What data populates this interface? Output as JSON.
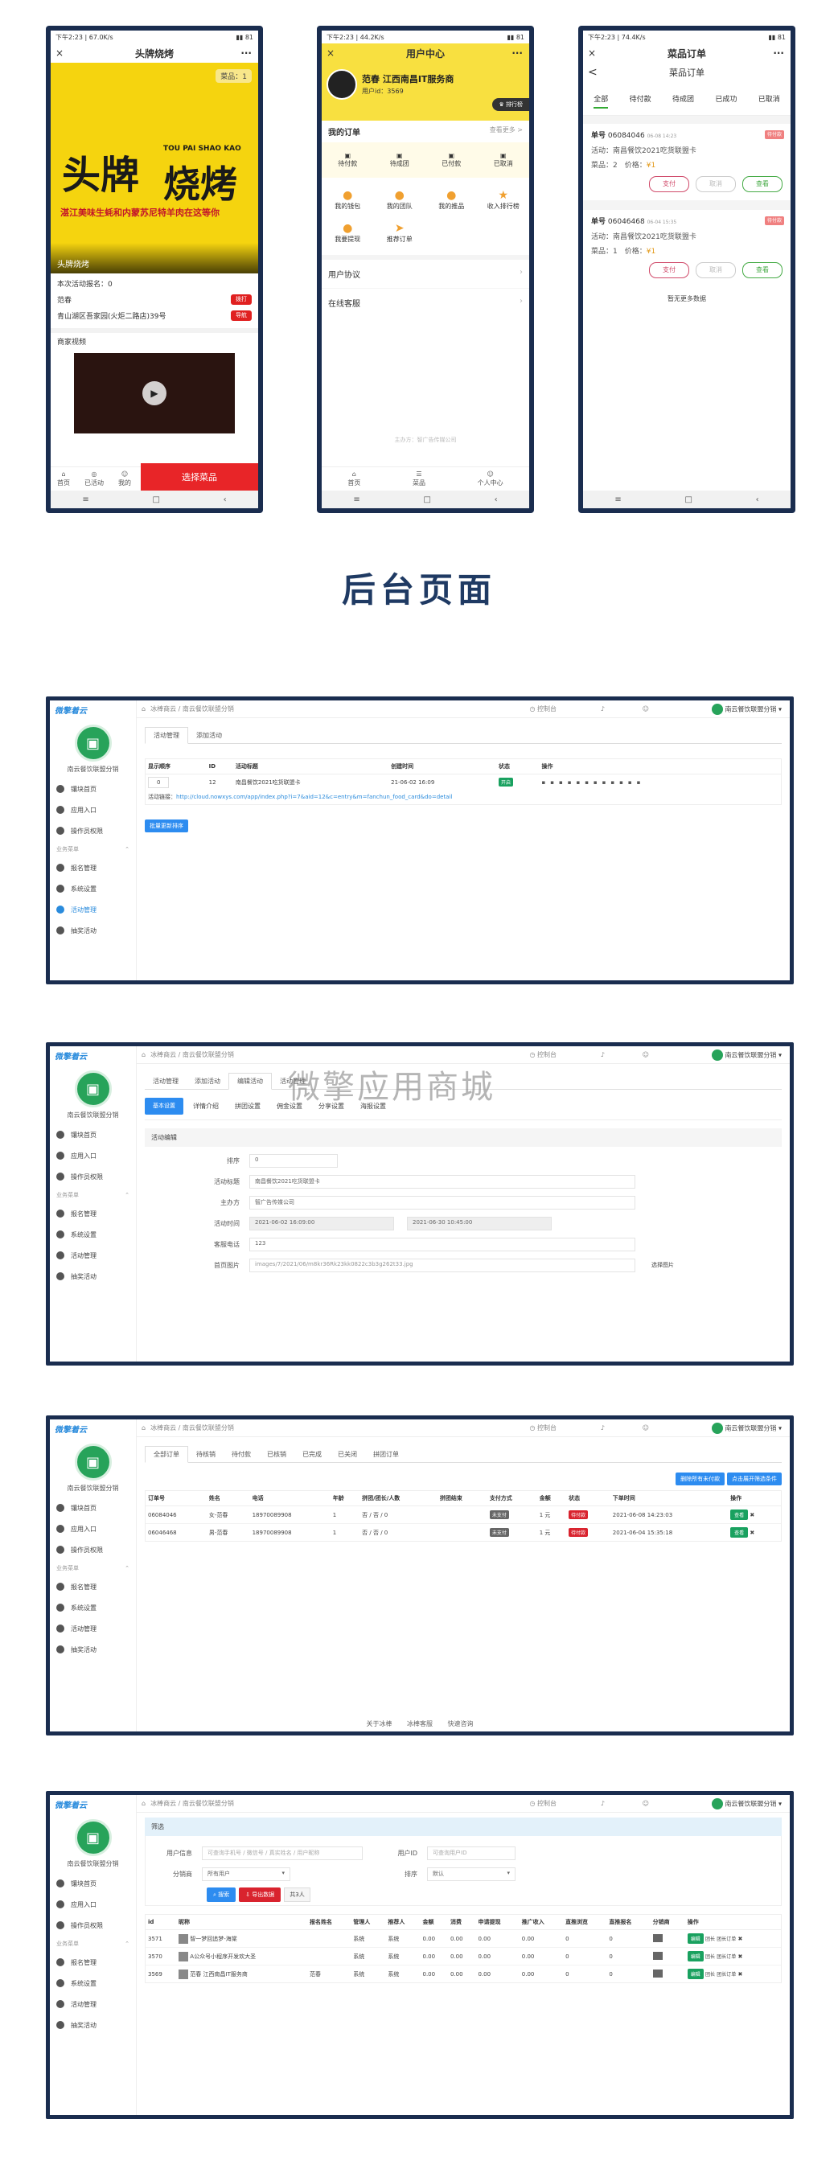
{
  "phone1": {
    "status_time": "下午2:23 | 67.0K/s",
    "title": "头牌烧烤",
    "close": "×",
    "more": "···",
    "banner_badge": "菜品：1",
    "banner_big1": "头牌",
    "banner_big2": "烧烤",
    "banner_pinyin": "TOU PAI SHAO KAO",
    "banner_sub": "湛江美味生蚝和内蒙苏尼特羊肉在这等你",
    "banner_caption": "头牌烧烤",
    "activity_count": "本次活动报名：0",
    "person": "范春",
    "address": "青山湖区吾家园(火炬二路店)39号",
    "btn_call": "拨打",
    "btn_nav": "导航",
    "video_title": "商家视频",
    "tab_home": "首页",
    "tab_activity": "已活动",
    "tab_mine": "我的",
    "select_button": "选择菜品"
  },
  "phone2": {
    "status_time": "下午2:23 | 44.2K/s",
    "title": "用户中心",
    "close": "×",
    "more": "···",
    "user_name": "范春 江西南昌IT服务商",
    "user_id": "用户id：3569",
    "rank_btn": "排行榜",
    "orders_title": "我的订单",
    "orders_more": "查看更多 >",
    "order_icons": [
      "待付款",
      "待成团",
      "已付款",
      "已取消"
    ],
    "grid_row1": [
      "我的钱包",
      "我的团队",
      "我的推品",
      "收入排行榜"
    ],
    "grid_row2": [
      "我要提现",
      "推荐订单"
    ],
    "agreement": "用户协议",
    "service": "在线客服",
    "copyright": "主办方：智广告传媒公司",
    "tab_home": "首页",
    "tab_menu": "菜品",
    "tab_mine": "个人中心"
  },
  "phone3": {
    "status_time": "下午2:23 | 74.4K/s",
    "title": "菜品订单",
    "close": "×",
    "more": "···",
    "back": "<",
    "subtitle": "菜品订单",
    "tabs": [
      "全部",
      "待付款",
      "待成团",
      "已成功",
      "已取消"
    ],
    "orders": [
      {
        "no_label": "单号",
        "no": "06084046",
        "time": "06-08 14:23",
        "status": "待付款",
        "activity": "活动：南昌餐饮2021吃货联盟卡",
        "dish": "菜品：2",
        "price_label": "价格：",
        "price": "¥1",
        "b1": "支付",
        "b2": "取消",
        "b3": "查看"
      },
      {
        "no_label": "单号",
        "no": "06046468",
        "time": "06-04 15:35",
        "status": "待付款",
        "activity": "活动：南昌餐饮2021吃货联盟卡",
        "dish": "菜品：1",
        "price_label": "价格：",
        "price": "¥1",
        "b1": "支付",
        "b2": "取消",
        "b3": "查看"
      }
    ],
    "no_more": "暂无更多数据"
  },
  "heading": "后台页面",
  "watermark": "微擎应用商城",
  "common": {
    "logo": "微擎着云",
    "breadcrumb": "冰棒商云 / 南云餐饮联盟分销",
    "console": "控制台",
    "shop_name": "南云餐饮联盟分销",
    "side_items": [
      "镶块首页",
      "应用入口",
      "操作员权限"
    ],
    "side_group": "业务菜单",
    "side_biz": [
      "报名管理",
      "系统设置",
      "活动管理",
      "抽奖活动"
    ]
  },
  "panel1": {
    "tabs": [
      "活动管理",
      "添加活动"
    ],
    "headers": [
      "显示顺序",
      "ID",
      "活动标题",
      "创建时间",
      "状态",
      "操作"
    ],
    "row": [
      "0",
      "12",
      "南昌餐饮2021吃货联盟卡",
      "21-06-02 16:09",
      "开启"
    ],
    "link_label": "活动链接：",
    "link": "http://cloud.nowxys.com/app/index.php?i=7&aid=12&c=entry&m=fanchun_food_card&do=detail",
    "batch_btn": "批量更新排序"
  },
  "panel2": {
    "tabs": [
      "活动管理",
      "添加活动",
      "编辑活动",
      "活动管理"
    ],
    "subtabs": [
      "基本设置",
      "详情介绍",
      "拼团设置",
      "佣金设置",
      "分享设置",
      "海报设置"
    ],
    "section": "活动编辑",
    "fields": [
      {
        "label": "排序",
        "value": "0"
      },
      {
        "label": "活动标题",
        "value": "南昌餐饮2021吃货联盟卡"
      },
      {
        "label": "主办方",
        "value": "智广告传媒公司"
      },
      {
        "label": "活动时间",
        "value": "2021-06-02 16:09:00",
        "value2": "2021-06-30 10:45:00"
      },
      {
        "label": "客服电话",
        "value": "123"
      },
      {
        "label": "首页图片",
        "value": "images/7/2021/06/m8kr36Rk23kk0822c3b3g262t33.jpg",
        "extra": "选择图片"
      }
    ]
  },
  "panel3": {
    "tabs": [
      "全部订单",
      "待核销",
      "待付款",
      "已核销",
      "已完成",
      "已关闭",
      "拼团订单"
    ],
    "btn1": "删除所有未付款",
    "btn2": "点击展开筛选条件",
    "headers": [
      "订单号",
      "姓名",
      "电话",
      "年龄",
      "拼团/团长/人数",
      "拼团结束",
      "支付方式",
      "金额",
      "状态",
      "下单时间",
      "操作"
    ],
    "rows": [
      [
        "06084046",
        "女-范春",
        "18970089908",
        "1",
        "否 / 否 / 0",
        "",
        "未支付",
        "1 元",
        "待付款",
        "2021-06-08 14:23:03",
        "查看"
      ],
      [
        "06046468",
        "男-范春",
        "18970089908",
        "1",
        "否 / 否 / 0",
        "",
        "未支付",
        "1 元",
        "待付款",
        "2021-06-04 15:35:18",
        "查看"
      ]
    ],
    "footer": [
      "关于冰棒",
      "冰棒客服",
      "快速咨询"
    ]
  },
  "panel4": {
    "filter_title": "筛选",
    "user_info_label": "用户信息",
    "user_info_ph": "可查询手机号 / 微信号 / 真实姓名 / 用户昵称",
    "user_id_label": "用户ID",
    "user_id_ph": "可查询用户ID",
    "dist_label": "分销商",
    "dist_value": "所有用户",
    "sort_label": "排序",
    "sort_value": "默认",
    "search_btn": "搜索",
    "export_btn": "导出数据",
    "total": "共3人",
    "headers": [
      "id",
      "昵称",
      "报名姓名",
      "管理人",
      "推荐人",
      "金额",
      "消费",
      "申请提现",
      "推广收入",
      "直推浏览",
      "直推报名",
      "分销商",
      "操作"
    ],
    "rows": [
      [
        "3571",
        "智一梦回追梦-海棠",
        "",
        "系统",
        "系统",
        "0.00",
        "0.00",
        "0.00",
        "0.00",
        "0",
        "0"
      ],
      [
        "3570",
        "A公众号小程序开发欢大圣",
        "",
        "系统",
        "系统",
        "0.00",
        "0.00",
        "0.00",
        "0.00",
        "0",
        "0"
      ],
      [
        "3569",
        "范春 江西南昌IT服务商",
        "范春",
        "系统",
        "系统",
        "0.00",
        "0.00",
        "0.00",
        "0.00",
        "0",
        "0"
      ]
    ],
    "row_btns": [
      "编辑",
      "团长",
      "团长订单"
    ]
  }
}
